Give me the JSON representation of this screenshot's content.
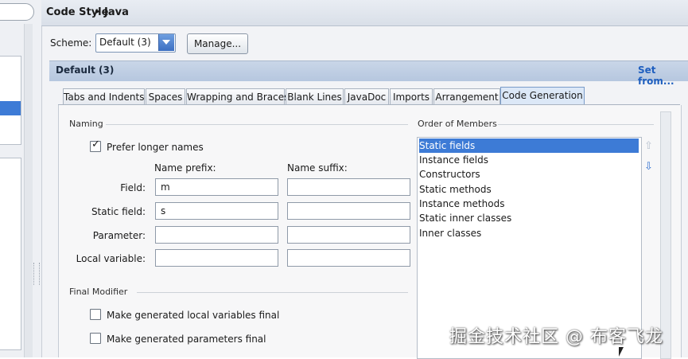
{
  "header": {
    "title": "Code Style",
    "breadcrumb_sep": "▸",
    "subtitle": "Java"
  },
  "scheme": {
    "label": "Scheme:",
    "value": "Default (3)",
    "manage_label": "Manage..."
  },
  "section": {
    "title": "Default (3)",
    "set_from": "Set from..."
  },
  "tabs": [
    {
      "label": "Tabs and Indents"
    },
    {
      "label": "Spaces"
    },
    {
      "label": "Wrapping and Braces"
    },
    {
      "label": "Blank Lines"
    },
    {
      "label": "JavaDoc"
    },
    {
      "label": "Imports"
    },
    {
      "label": "Arrangement"
    },
    {
      "label": "Code Generation",
      "active": true
    }
  ],
  "naming": {
    "group_label": "Naming",
    "prefer_longer": {
      "label": "Prefer longer names",
      "checked": true
    },
    "prefix_header": "Name prefix:",
    "suffix_header": "Name suffix:",
    "rows": [
      {
        "label": "Field:",
        "prefix": "m",
        "suffix": ""
      },
      {
        "label": "Static field:",
        "prefix": "s",
        "suffix": ""
      },
      {
        "label": "Parameter:",
        "prefix": "",
        "suffix": ""
      },
      {
        "label": "Local variable:",
        "prefix": "",
        "suffix": ""
      }
    ]
  },
  "final_modifier": {
    "group_label": "Final Modifier",
    "options": [
      {
        "label": "Make generated local variables final",
        "checked": false
      },
      {
        "label": "Make generated parameters final",
        "checked": false
      }
    ]
  },
  "order": {
    "group_label": "Order of Members",
    "items": [
      "Static fields",
      "Instance fields",
      "Constructors",
      "Static methods",
      "Instance methods",
      "Static inner classes",
      "Inner classes"
    ],
    "selected_index": 0,
    "move_up_icon": "arrow-up-icon",
    "move_down_icon": "arrow-down-icon"
  },
  "watermark": "掘金技术社区 @ 布客飞龙",
  "colors": {
    "selection": "#3d7bd6",
    "link": "#1f5fbf",
    "section_bar": "#c9d6e8"
  }
}
